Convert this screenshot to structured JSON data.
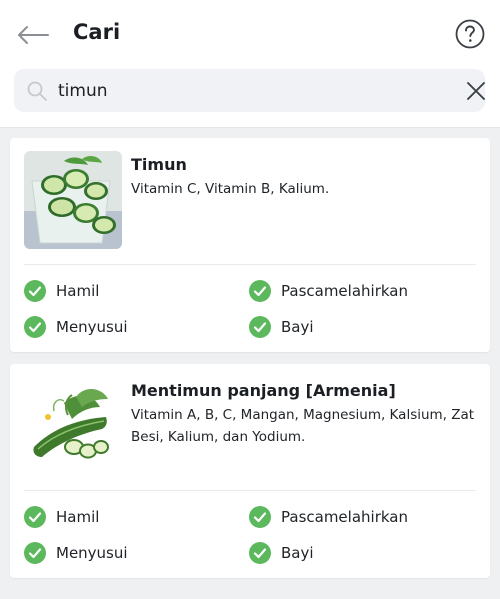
{
  "header": {
    "title": "Cari"
  },
  "search": {
    "value": "timun",
    "placeholder": ""
  },
  "colors": {
    "check_green": "#5cb85c",
    "background": "#eef0f2"
  },
  "results": [
    {
      "name": "Timun",
      "description": "Vitamin C, Vitamin B, Kalium.",
      "statuses": {
        "hamil": "Hamil",
        "pascamelahirkan": "Pascamelahirkan",
        "menyusui": "Menyusui",
        "bayi": "Bayi"
      }
    },
    {
      "name": "Mentimun panjang [Armenia]",
      "description": "Vitamin A, B, C, Mangan, Magnesium, Kalsium, Zat Besi, Kalium, dan Yodium.",
      "statuses": {
        "hamil": "Hamil",
        "pascamelahirkan": "Pascamelahirkan",
        "menyusui": "Menyusui",
        "bayi": "Bayi"
      }
    }
  ]
}
